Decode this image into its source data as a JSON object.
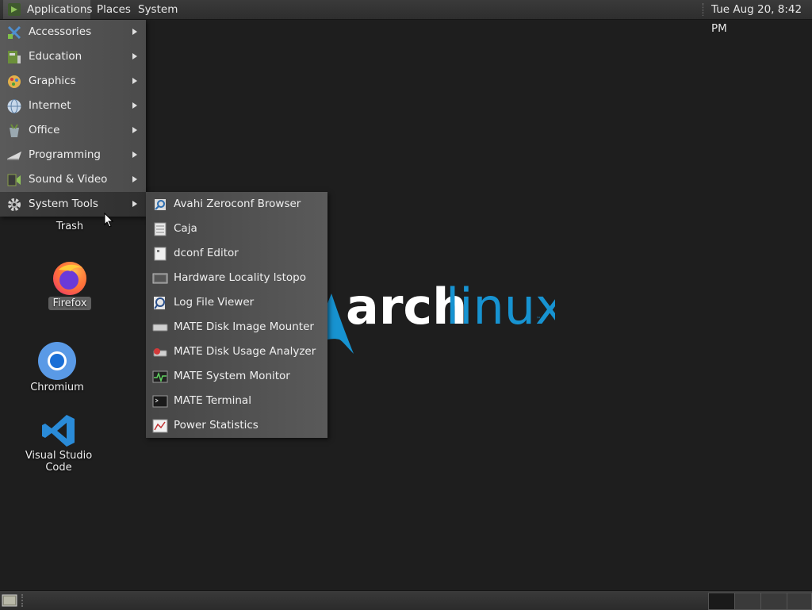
{
  "top_panel": {
    "applications_label": "Applications",
    "places_label": "Places",
    "system_label": "System",
    "clock": "Tue Aug 20,  8:42 PM"
  },
  "apps_menu": {
    "items": [
      {
        "label": "Accessories",
        "icon": "accessories-icon"
      },
      {
        "label": "Education",
        "icon": "education-icon"
      },
      {
        "label": "Graphics",
        "icon": "graphics-icon"
      },
      {
        "label": "Internet",
        "icon": "internet-icon"
      },
      {
        "label": "Office",
        "icon": "office-icon"
      },
      {
        "label": "Programming",
        "icon": "programming-icon"
      },
      {
        "label": "Sound & Video",
        "icon": "sound-video-icon"
      },
      {
        "label": "System Tools",
        "icon": "system-tools-icon",
        "active": true
      }
    ]
  },
  "system_tools_menu": {
    "items": [
      {
        "label": "Avahi Zeroconf Browser",
        "icon": "avahi-icon"
      },
      {
        "label": "Caja",
        "icon": "caja-icon"
      },
      {
        "label": "dconf Editor",
        "icon": "dconf-icon"
      },
      {
        "label": "Hardware Locality lstopo",
        "icon": "hardware-icon"
      },
      {
        "label": "Log File Viewer",
        "icon": "log-viewer-icon"
      },
      {
        "label": "MATE Disk Image Mounter",
        "icon": "disk-mounter-icon"
      },
      {
        "label": "MATE Disk Usage Analyzer",
        "icon": "disk-usage-icon"
      },
      {
        "label": "MATE System Monitor",
        "icon": "system-monitor-icon"
      },
      {
        "label": "MATE Terminal",
        "icon": "terminal-icon"
      },
      {
        "label": "Power Statistics",
        "icon": "power-stats-icon"
      }
    ]
  },
  "desktop": {
    "wallpaper_text_1": "arch",
    "wallpaper_text_2": "linux",
    "icons": [
      {
        "label": "Trash"
      },
      {
        "label": "Firefox"
      },
      {
        "label": "Chromium"
      },
      {
        "label": "Visual Studio Code"
      }
    ]
  },
  "colors": {
    "arch_blue": "#1793d1",
    "menu_bg": "#555555",
    "desktop_bg": "#1e1e1e"
  }
}
